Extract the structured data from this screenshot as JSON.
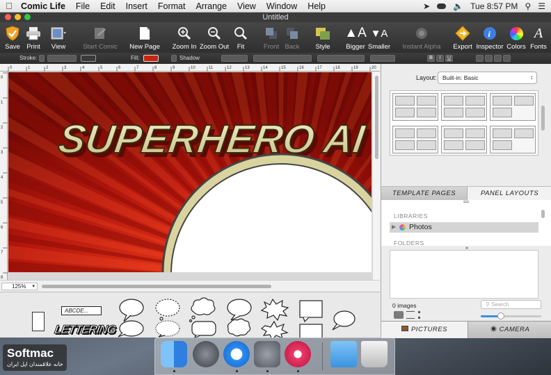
{
  "menubar": {
    "app_name": "Comic Life",
    "items": [
      "File",
      "Edit",
      "Insert",
      "Format",
      "Arrange",
      "View",
      "Window",
      "Help"
    ],
    "clock": "Tue 8:57 PM"
  },
  "window": {
    "title": "Untitled"
  },
  "toolbar": {
    "save": "Save",
    "print": "Print",
    "view": "View",
    "start_comic": "Start Comic",
    "new_page": "New Page",
    "zoom_in": "Zoom In",
    "zoom_out": "Zoom Out",
    "fit": "Fit",
    "front": "Front",
    "back": "Back",
    "style": "Style",
    "bigger": "Bigger",
    "smaller": "Smaller",
    "instant_alpha": "Instant Alpha",
    "export": "Export",
    "inspector": "Inspector",
    "colors": "Colors",
    "fonts": "Fonts"
  },
  "formatbar": {
    "stroke": "Stroke:",
    "fill": "Fill:",
    "shadow": "Shadow",
    "bold": "B",
    "italic": "I",
    "underline": "U",
    "fill_color": "#c8250f"
  },
  "canvas": {
    "title_text": "SUPERHERO AI",
    "zoom": "125%",
    "ruler_top": [
      "0",
      "1",
      "2",
      "3",
      "4",
      "5",
      "6",
      "7",
      "8",
      "9",
      "10",
      "11",
      "12",
      "13",
      "14",
      "15",
      "16",
      "17",
      "18",
      "19",
      "20"
    ],
    "ruler_left": [
      "0",
      "1",
      "2",
      "3",
      "4",
      "5",
      "6",
      "7",
      "8"
    ]
  },
  "balloons": {
    "lettering_box": "ABCDE...",
    "lettering_art": "LETTERING"
  },
  "panel": {
    "layout_label": "Layout:",
    "layout_value": "Built-in: Basic",
    "tab_template_pages": "TEMPLATE PAGES",
    "tab_panel_layouts": "PANEL LAYOUTS",
    "libraries_header": "LIBRARIES",
    "libraries_item": "Photos",
    "folders_header": "FOLDERS",
    "images_count": "0 images",
    "search_placeholder": "Search",
    "tab_pictures": "PICTURES",
    "tab_camera": "CAMERA",
    "slider_value": 0.33
  },
  "watermark": {
    "brand": "Softmac",
    "subtitle": "خانه علاقمندان اپل ایران"
  },
  "colors": {
    "red_bg": "#b3160d",
    "accent_blue": "#3a8ee6",
    "comic_cream": "#d9d3a0"
  }
}
